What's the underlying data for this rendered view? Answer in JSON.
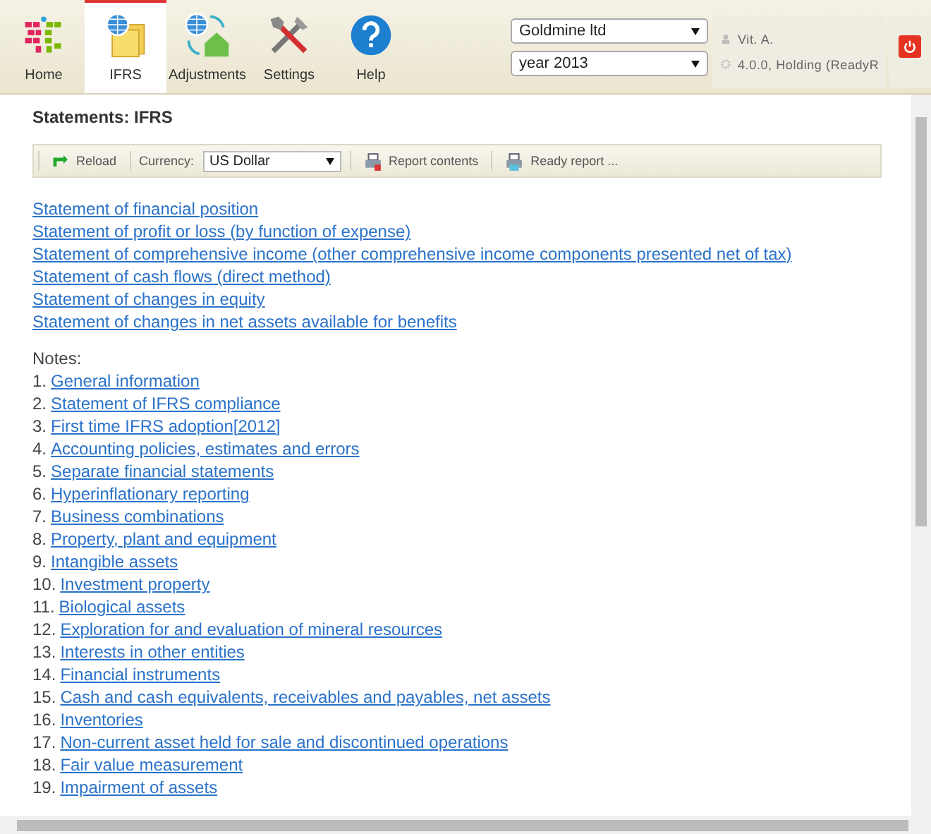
{
  "nav": [
    {
      "label": "Home",
      "kind": "logo",
      "selected": false
    },
    {
      "label": "IFRS",
      "kind": "globe-folders",
      "selected": true
    },
    {
      "label": "Adjustments",
      "kind": "globe-house",
      "selected": false
    },
    {
      "label": "Settings",
      "kind": "tools",
      "selected": false
    },
    {
      "label": "Help",
      "kind": "help",
      "selected": false
    }
  ],
  "company_select": {
    "value": "Goldmine ltd"
  },
  "year_select": {
    "value": "year 2013"
  },
  "user": {
    "name": "Vit. A.",
    "version": "4.0.0, Holding (ReadyR"
  },
  "page_title": "Statements: IFRS",
  "toolbar": {
    "reload": "Reload",
    "currency_label": "Currency:",
    "currency": "US Dollar",
    "report_contents": "Report contents",
    "ready_report": "Ready report ..."
  },
  "statements": [
    "Statement of financial position",
    "Statement of profit or loss (by function of expense)",
    "Statement of comprehensive income (other comprehensive income components presented net of tax)",
    "Statement of cash flows (direct method)",
    "Statement of changes in equity",
    "Statement of changes in net assets available for benefits"
  ],
  "notes_label": "Notes:",
  "notes": [
    {
      "number": "1.",
      "title": "General information"
    },
    {
      "number": "2.",
      "title": "Statement of IFRS compliance"
    },
    {
      "number": "3.",
      "title": "First time IFRS adoption[2012]"
    },
    {
      "number": "4.",
      "title": "Accounting policies, estimates and errors"
    },
    {
      "number": "5.",
      "title": "Separate financial statements"
    },
    {
      "number": "6.",
      "title": "Hyperinflationary reporting"
    },
    {
      "number": "7.",
      "title": "Business combinations"
    },
    {
      "number": "8.",
      "title": "Property, plant and equipment"
    },
    {
      "number": "9.",
      "title": "Intangible assets"
    },
    {
      "number": "10.",
      "title": "Investment property"
    },
    {
      "number": "11.",
      "title": "Biological assets"
    },
    {
      "number": "12.",
      "title": "Exploration for and evaluation of mineral resources"
    },
    {
      "number": "13.",
      "title": "Interests in other entities"
    },
    {
      "number": "14.",
      "title": "Financial instruments"
    },
    {
      "number": "15.",
      "title": "Cash and cash equivalents, receivables and payables, net assets"
    },
    {
      "number": "16.",
      "title": "Inventories"
    },
    {
      "number": "17.",
      "title": "Non-current asset held for sale and discontinued operations"
    },
    {
      "number": "18.",
      "title": "Fair value measurement"
    },
    {
      "number": "19.",
      "title": "Impairment of assets"
    }
  ]
}
